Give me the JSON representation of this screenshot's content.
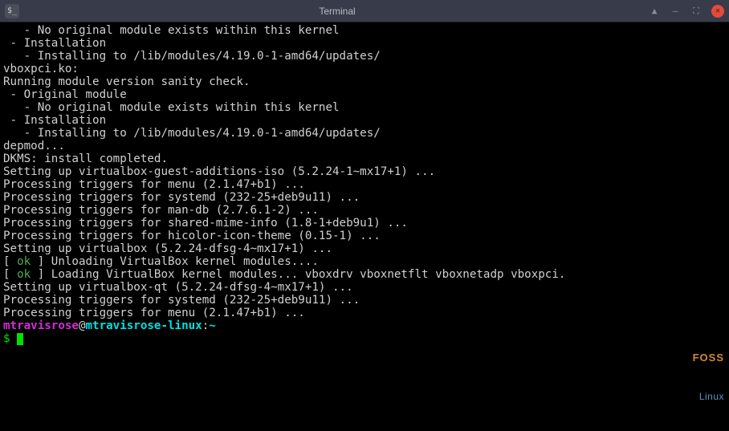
{
  "window": {
    "title": "Terminal",
    "icon_glyph": "$_"
  },
  "terminal": {
    "lines": [
      "   - No original module exists within this kernel",
      " - Installation",
      "   - Installing to /lib/modules/4.19.0-1-amd64/updates/",
      "",
      "vboxpci.ko:",
      "Running module version sanity check.",
      " - Original module",
      "   - No original module exists within this kernel",
      " - Installation",
      "   - Installing to /lib/modules/4.19.0-1-amd64/updates/",
      "",
      "depmod...",
      "",
      "DKMS: install completed.",
      "Setting up virtualbox-guest-additions-iso (5.2.24-1~mx17+1) ...",
      "Processing triggers for menu (2.1.47+b1) ...",
      "Processing triggers for systemd (232-25+deb9u11) ...",
      "Processing triggers for man-db (2.7.6.1-2) ...",
      "Processing triggers for shared-mime-info (1.8-1+deb9u1) ...",
      "Processing triggers for hicolor-icon-theme (0.15-1) ...",
      "Setting up virtualbox (5.2.24-dfsg-4~mx17+1) ..."
    ],
    "ok_lines": [
      {
        "prefix": "[ ",
        "ok": "ok",
        "suffix": " ] Unloading VirtualBox kernel modules...."
      },
      {
        "prefix": "[ ",
        "ok": "ok",
        "suffix": " ] Loading VirtualBox kernel modules... vboxdrv vboxnetflt vboxnetadp vboxpci."
      }
    ],
    "lines_after": [
      "Setting up virtualbox-qt (5.2.24-dfsg-4~mx17+1) ...",
      "Processing triggers for systemd (232-25+deb9u11) ...",
      "Processing triggers for menu (2.1.47+b1) ..."
    ],
    "prompt": {
      "user": "mtravisrose",
      "at": "@",
      "host": "mtravisrose-linux",
      "colon": ":",
      "path": "~",
      "dollar": "$ "
    }
  },
  "watermark": {
    "line1": "FOSS",
    "line2": "Linux"
  }
}
